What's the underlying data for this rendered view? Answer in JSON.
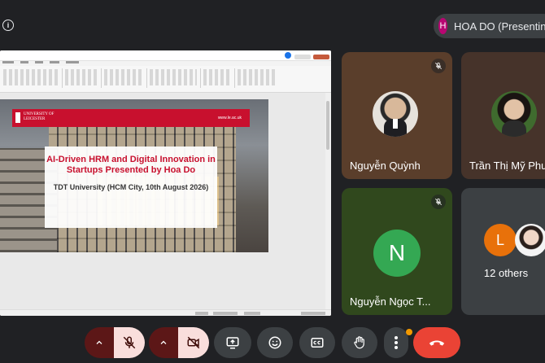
{
  "presenter": {
    "avatar_letter": "H",
    "label": "HOA DO (Presenting)"
  },
  "presentation": {
    "banner_university": "UNIVERSITY OF LEICESTER",
    "banner_url": "www.le.ac.uk",
    "title": "AI-Driven HRM and Digital Innovation in Startups Presented by Hoa Do",
    "subtitle": "TDT University (HCM City, 10th August 2026)"
  },
  "participants": [
    {
      "name": "Nguyễn Quỳnh",
      "muted": true,
      "tile_color": "#5a3e2b"
    },
    {
      "name": "Trần Thị Mỹ Phương",
      "muted": false,
      "tile_color": "#46332a"
    },
    {
      "name": "Nguyễn Ngọc T...",
      "muted": true,
      "avatar_letter": "N",
      "avatar_color": "#34a853",
      "tile_color": "#30481d"
    }
  ],
  "others": {
    "avatar_letter": "L",
    "avatar_color": "#e8710a",
    "label": "12 others"
  },
  "controls": {
    "mic": "mic-off",
    "camera": "camera-off",
    "present": "present-screen",
    "reactions": "emoji",
    "captions": "closed-captions",
    "raise_hand": "hand",
    "more": "more-options",
    "leave": "end-call"
  },
  "colors": {
    "background": "#202124",
    "control_gray": "#3c4043",
    "toggle_off": "#f9dedc",
    "leave_red": "#ea4335",
    "notification": "#f29900"
  }
}
